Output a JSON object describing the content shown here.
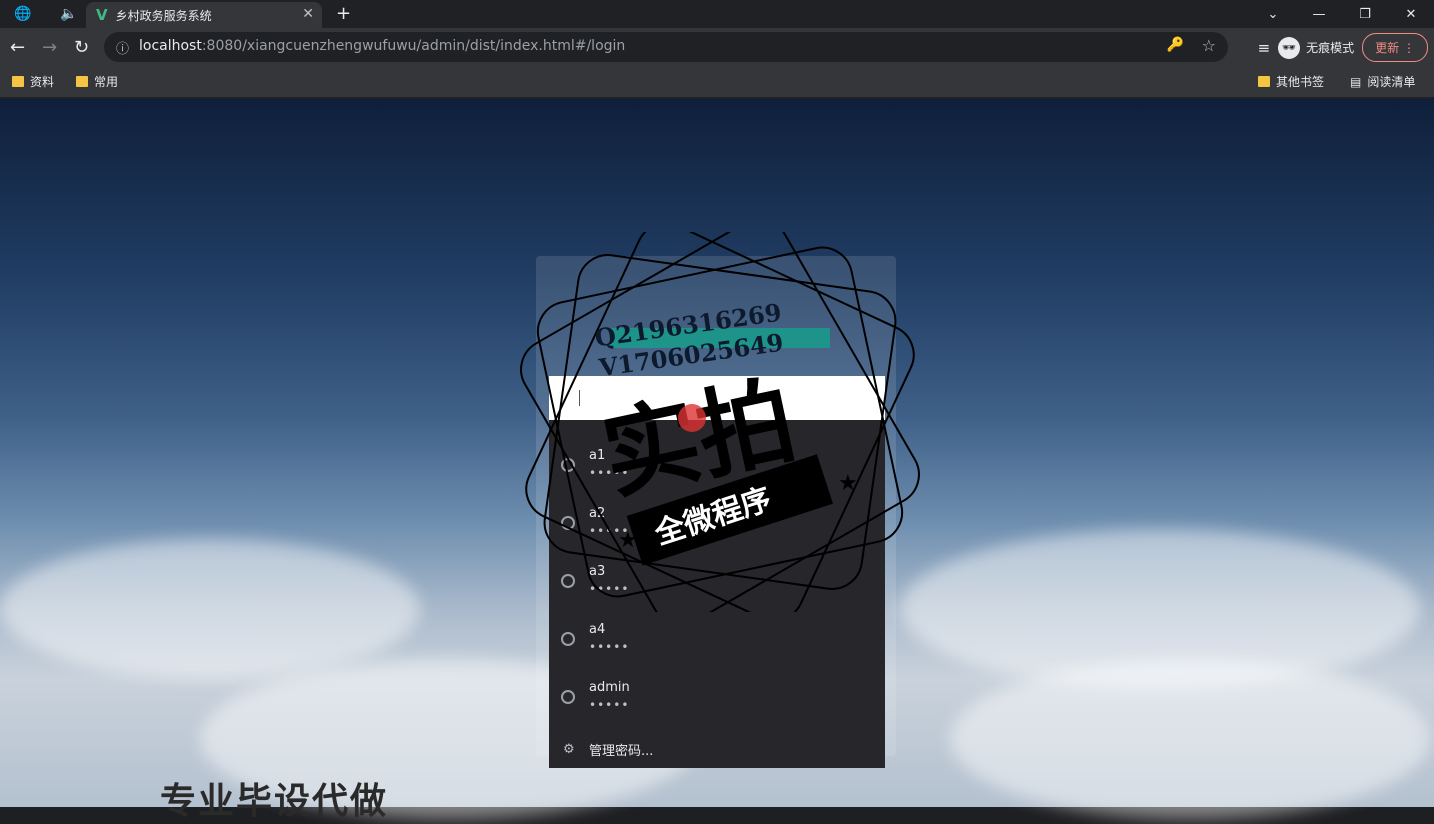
{
  "browser": {
    "tab_title": "乡村政务服务系统",
    "url_host": "localhost",
    "url_rest": ":8080/xiangcuenzhengwufuwu/admin/dist/index.html#/login",
    "incognito_label": "无痕模式",
    "update_label": "更新",
    "bookmarks": [
      "资料",
      "常用"
    ],
    "other_bookmarks": "其他书签",
    "reading_list": "阅读清单"
  },
  "autocomplete": {
    "accounts": [
      {
        "name": "a1",
        "password": "•••••"
      },
      {
        "name": "a2",
        "password": "•••••"
      },
      {
        "name": "a3",
        "password": "•••••"
      },
      {
        "name": "a4",
        "password": "•••••"
      },
      {
        "name": "admin",
        "password": "•••••"
      }
    ],
    "manage_label": "管理密码..."
  },
  "watermark": {
    "qq": "Q2196316269",
    "wechat": "V1706025649",
    "main": "实拍",
    "banner": "全微程序"
  },
  "page": {
    "bottom_text": "专业毕设代做"
  },
  "colors": {
    "chrome_dark": "#202124",
    "chrome_toolbar": "#35363a",
    "vue_green": "#42b883",
    "update_red": "#f28b82"
  }
}
